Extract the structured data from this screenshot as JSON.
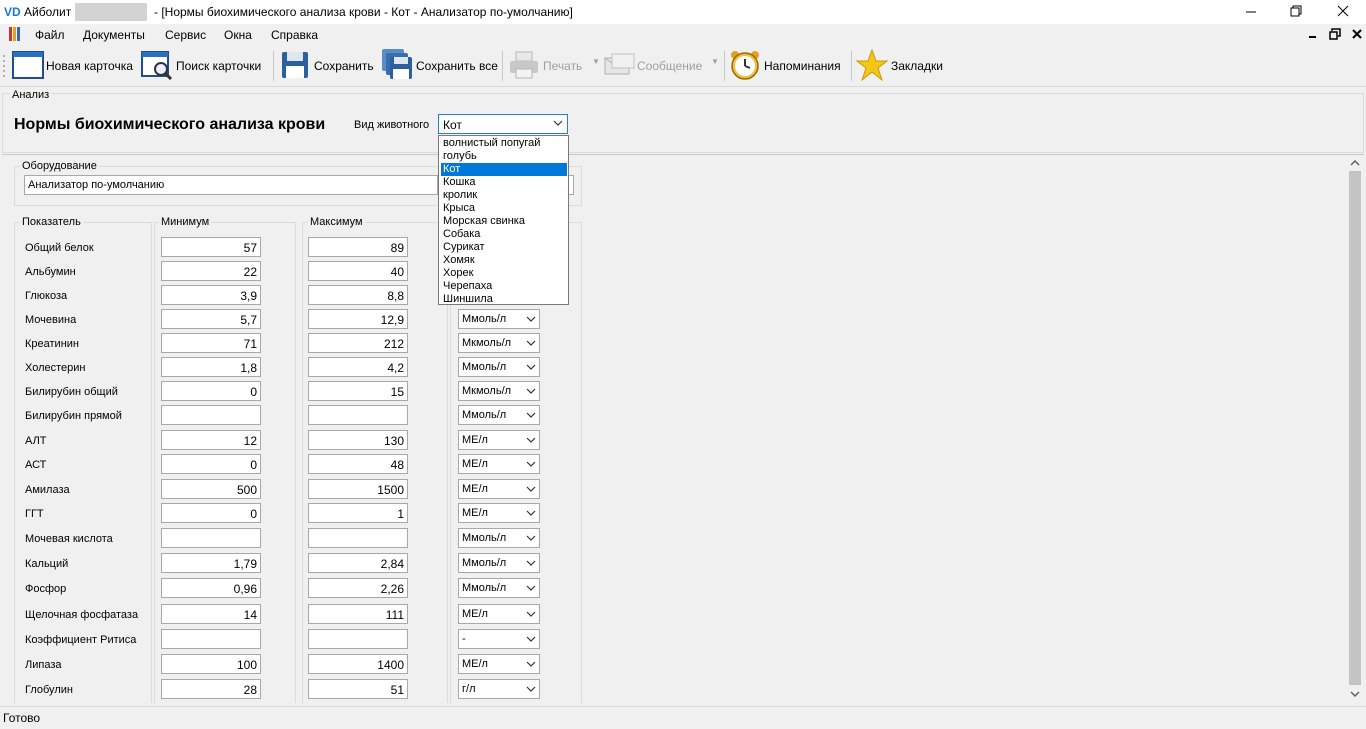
{
  "window": {
    "app_logo": "VD",
    "app_name": "Айболит",
    "document_title": "- [Нормы биохимического анализа крови - Кот - Анализатор по-умолчанию]"
  },
  "menu": [
    "Файл",
    "Документы",
    "Сервис",
    "Окна",
    "Справка"
  ],
  "toolbar": {
    "new_card": "Новая карточка",
    "search_card": "Поиск карточки",
    "save": "Сохранить",
    "save_all": "Сохранить все",
    "print": "Печать",
    "message": "Сообщение",
    "reminders": "Напоминания",
    "bookmarks": "Закладки"
  },
  "analysis": {
    "group_label": "Анализ",
    "form_title": "Нормы биохимического анализа крови",
    "species_label": "Вид животного",
    "species_value": "Кот",
    "species_options": [
      "волнистый попугай",
      "голубь",
      "Кот",
      "Кошка",
      "кролик",
      "Крыса",
      "Морская свинка",
      "Собака",
      "Сурикат",
      "Хомяк",
      "Хорек",
      "Черепаха",
      "Шиншила"
    ],
    "species_selected_index": 2
  },
  "equipment": {
    "group_label": "Оборудование",
    "value": "Анализатор по-умолчанию"
  },
  "columns": {
    "indicator": "Показатель",
    "min": "Минимум",
    "max": "Максимум"
  },
  "rows": [
    {
      "name": "Общий белок",
      "min": "57",
      "max": "89",
      "unit": ""
    },
    {
      "name": "Альбумин",
      "min": "22",
      "max": "40",
      "unit": ""
    },
    {
      "name": "Глюкоза",
      "min": "3,9",
      "max": "8,8",
      "unit": ""
    },
    {
      "name": "Мочевина",
      "min": "5,7",
      "max": "12,9",
      "unit": "Ммоль/л"
    },
    {
      "name": "Креатинин",
      "min": "71",
      "max": "212",
      "unit": "Мкмоль/л"
    },
    {
      "name": "Холестерин",
      "min": "1,8",
      "max": "4,2",
      "unit": "Ммоль/л"
    },
    {
      "name": "Билирубин общий",
      "min": "0",
      "max": "15",
      "unit": "Мкмоль/л"
    },
    {
      "name": "Билирубин прямой",
      "min": "",
      "max": "",
      "unit": "Ммоль/л"
    },
    {
      "name": "АЛТ",
      "min": "12",
      "max": "130",
      "unit": "МЕ/л"
    },
    {
      "name": "АСТ",
      "min": "0",
      "max": "48",
      "unit": "МЕ/л"
    },
    {
      "name": "Амилаза",
      "min": "500",
      "max": "1500",
      "unit": "МЕ/л"
    },
    {
      "name": "ГГТ",
      "min": "0",
      "max": "1",
      "unit": "МЕ/л"
    },
    {
      "name": "Мочевая кислота",
      "min": "",
      "max": "",
      "unit": "Ммоль/л"
    },
    {
      "name": "Кальций",
      "min": "1,79",
      "max": "2,84",
      "unit": "Ммоль/л"
    },
    {
      "name": "Фосфор",
      "min": "0,96",
      "max": "2,26",
      "unit": "Ммоль/л"
    },
    {
      "name": "Щелочная фосфатаза",
      "min": "14",
      "max": "111",
      "unit": "МЕ/л"
    },
    {
      "name": "Коэффициент Ритиса",
      "min": "",
      "max": "",
      "unit": "-"
    },
    {
      "name": "Липаза",
      "min": "100",
      "max": "1400",
      "unit": "МЕ/л"
    },
    {
      "name": "Глобулин",
      "min": "28",
      "max": "51",
      "unit": "г/л"
    }
  ],
  "status": "Готово",
  "icons": {
    "new_card": "card-icon",
    "search_card": "search-card-icon",
    "save": "floppy-icon",
    "save_all": "floppy-stack-icon",
    "print": "printer-icon",
    "message": "envelope-icon",
    "reminders": "alarm-clock-icon",
    "bookmarks": "star-icon"
  }
}
